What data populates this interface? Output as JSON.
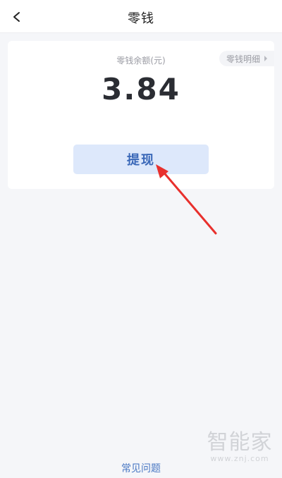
{
  "header": {
    "title": "零钱",
    "back_icon": "chevron-left-icon"
  },
  "card": {
    "balance_label": "零钱余额(元)",
    "balance_value": "3.84",
    "detail_link_label": "零钱明细",
    "detail_link_icon": "triangle-right-icon",
    "withdraw_label": "提现"
  },
  "annotation": {
    "arrow_color": "#e8302d"
  },
  "footer": {
    "faq_label": "常见问题"
  },
  "watermark": {
    "brand": "智能家",
    "url": "www.znj.com"
  },
  "colors": {
    "accent": "#3a68b8",
    "button_bg": "#dde8fb",
    "page_bg": "#f5f6f9"
  }
}
